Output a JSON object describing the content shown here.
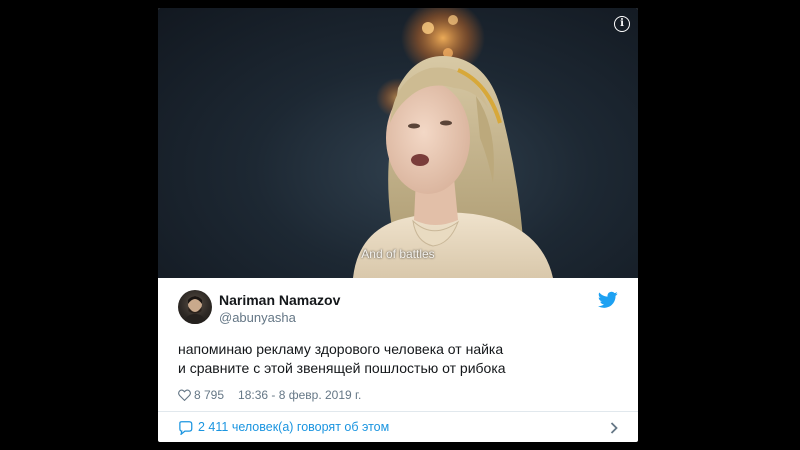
{
  "video": {
    "caption": "And of battles"
  },
  "tweet": {
    "author_name": "Nariman Namazov",
    "author_handle": "@abunyasha",
    "text_line1": "напоминаю рекламу здорового человека от найка",
    "text_line2": "и сравните с этой звенящей пошлостью от рибока",
    "likes": "8 795",
    "timestamp": "18:36 - 8 февр. 2019 г.",
    "replies_text": "2 411 человек(а) говорят об этом"
  },
  "colors": {
    "brand": "#1da1f2",
    "link": "#1b95e0",
    "muted": "#657786",
    "text": "#14171a"
  },
  "icons": {
    "info": "info-icon",
    "twitter": "twitter-bird-icon",
    "likes": "heart-icon",
    "replies": "speech-bubble-icon",
    "chevron": "chevron-right-icon"
  }
}
